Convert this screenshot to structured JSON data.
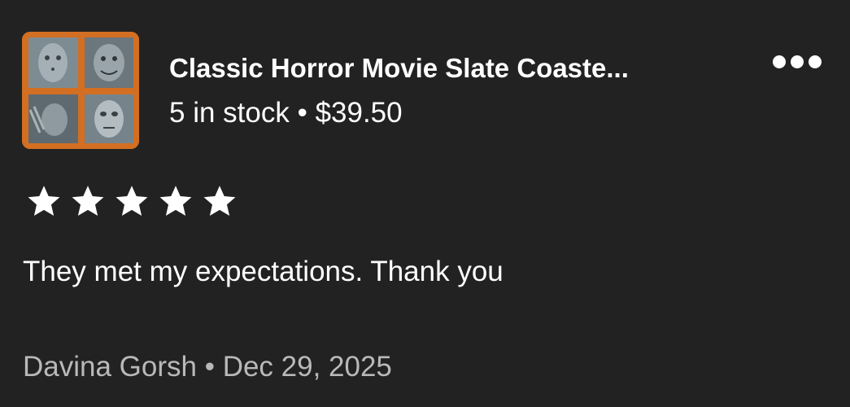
{
  "listing": {
    "title": "Classic Horror Movie Slate Coaste...",
    "stock": "5 in stock",
    "separator": " • ",
    "price": "$39.50",
    "thumbnail_icon": "horror-coasters-thumbnail"
  },
  "more_menu": {
    "icon": "more-horizontal-icon"
  },
  "review": {
    "rating": 5,
    "rating_max": 5,
    "text": "They met my expectations. Thank you",
    "author": "Davina Gorsh",
    "date": "Dec 29, 2025"
  },
  "colors": {
    "background": "#222222",
    "text": "#ffffff",
    "muted": "#b9b9b9",
    "thumb_bg": "#d2691e",
    "slate": "#6f7d86"
  }
}
